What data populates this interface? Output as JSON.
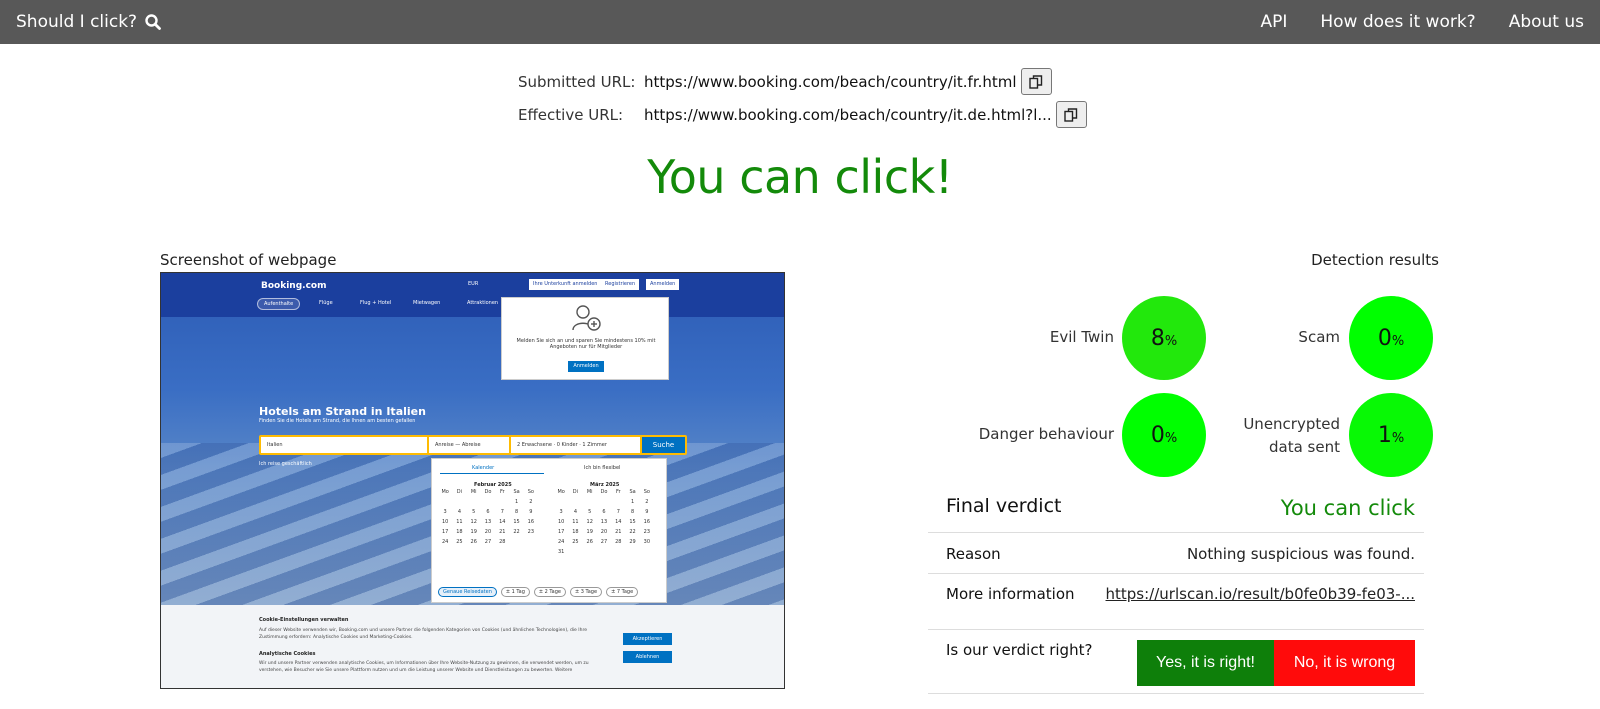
{
  "nav": {
    "brand": "Should I click?",
    "links": [
      "API",
      "How does it work?",
      "About us"
    ]
  },
  "urls": {
    "submitted_label": "Submitted URL:",
    "submitted_value": "https://www.booking.com/beach/country/it.fr.html",
    "effective_label": "Effective URL:",
    "effective_value": "https://www.booking.com/beach/country/it.de.html?l..."
  },
  "headline": "You can click!",
  "screenshot_label": "Screenshot of webpage",
  "detection_label": "Detection results",
  "screenshot": {
    "brand": "Booking.com",
    "currency": "EUR",
    "tabs": [
      "Aufenthalte",
      "Flüge",
      "Flug + Hotel",
      "Mietwagen",
      "Attraktionen"
    ],
    "buttons": [
      "Ihre Unterkunft anmelden",
      "Registrieren",
      "Anmelden"
    ],
    "popup_text": "Melden Sie sich an und sparen Sie mindestens 10% mit Angeboten nur für Mitglieder",
    "popup_button": "Anmelden",
    "title": "Hotels am Strand in Italien",
    "subtitle": "Finden Sie die Hotels am Strand, die Ihnen am besten gefallen",
    "destination": "Italien",
    "dates": "Anreise  —  Abreise",
    "guests": "2 Erwachsene · 0 Kinder · 1 Zimmer",
    "search_button": "Suche",
    "business_trip": "Ich reise geschäftlich",
    "cal_tabs": [
      "Kalender",
      "Ich bin flexibel"
    ],
    "months": [
      "Februar 2025",
      "März 2025"
    ],
    "weekdays": [
      "Mo",
      "Di",
      "Mi",
      "Do",
      "Fr",
      "Sa",
      "So"
    ],
    "feb_days": [
      "",
      "",
      "",
      "",
      "",
      "1",
      "2",
      "3",
      "4",
      "5",
      "6",
      "7",
      "8",
      "9",
      "10",
      "11",
      "12",
      "13",
      "14",
      "15",
      "16",
      "17",
      "18",
      "19",
      "20",
      "21",
      "22",
      "23",
      "24",
      "25",
      "26",
      "27",
      "28"
    ],
    "mar_days": [
      "",
      "",
      "",
      "",
      "",
      "1",
      "2",
      "3",
      "4",
      "5",
      "6",
      "7",
      "8",
      "9",
      "10",
      "11",
      "12",
      "13",
      "14",
      "15",
      "16",
      "17",
      "18",
      "19",
      "20",
      "21",
      "22",
      "23",
      "24",
      "25",
      "26",
      "27",
      "28",
      "29",
      "30",
      "31"
    ],
    "flex_chips": [
      "Genaue Reisedaten",
      "± 1 Tag",
      "± 2 Tage",
      "± 3 Tage",
      "± 7 Tage"
    ],
    "cookie_title": "Cookie-Einstellungen verwalten",
    "cookie_text": "Auf dieser Website verwenden wir, Booking.com und unsere Partner die folgenden Kategorien von Cookies (und ähnlichen Technologien), die Ihre Zustimmung erfordern: Analytische Cookies und Marketing-Cookies.",
    "cookie_sub": "Analytische Cookies",
    "cookie_text2": "Wir und unsere Partner verwenden analytische Cookies, um Informationen über Ihre Website-Nutzung zu gewinnen, die verwendet werden, um zu verstehen, wie Besucher wie Sie unsere Plattform nutzen und um die Leistung unserer Website und Dienstleistungen zu bewerten. Weitere",
    "accept": "Akzeptieren",
    "decline": "Ablehnen"
  },
  "detections": [
    {
      "label": "Evil Twin",
      "value": "8",
      "unit": "%",
      "color": "#22e80c"
    },
    {
      "label": "Scam",
      "value": "0",
      "unit": "%",
      "color": "#00ff00"
    },
    {
      "label": "Danger behaviour",
      "value": "0",
      "unit": "%",
      "color": "#00ff00"
    },
    {
      "label_line1": "Unencrypted",
      "label_line2": "data sent",
      "value": "1",
      "unit": "%",
      "color": "#08f905"
    }
  ],
  "verdict": {
    "final_label": "Final verdict",
    "final_value": "You can click",
    "reason_label": "Reason",
    "reason_value": "Nothing suspicious was found.",
    "more_label": "More information",
    "more_value": "https://urlscan.io/result/b0fe0b39-fe03-...",
    "question": "Is our verdict right?",
    "yes": "Yes, it is right!",
    "no": "No, it is wrong"
  }
}
